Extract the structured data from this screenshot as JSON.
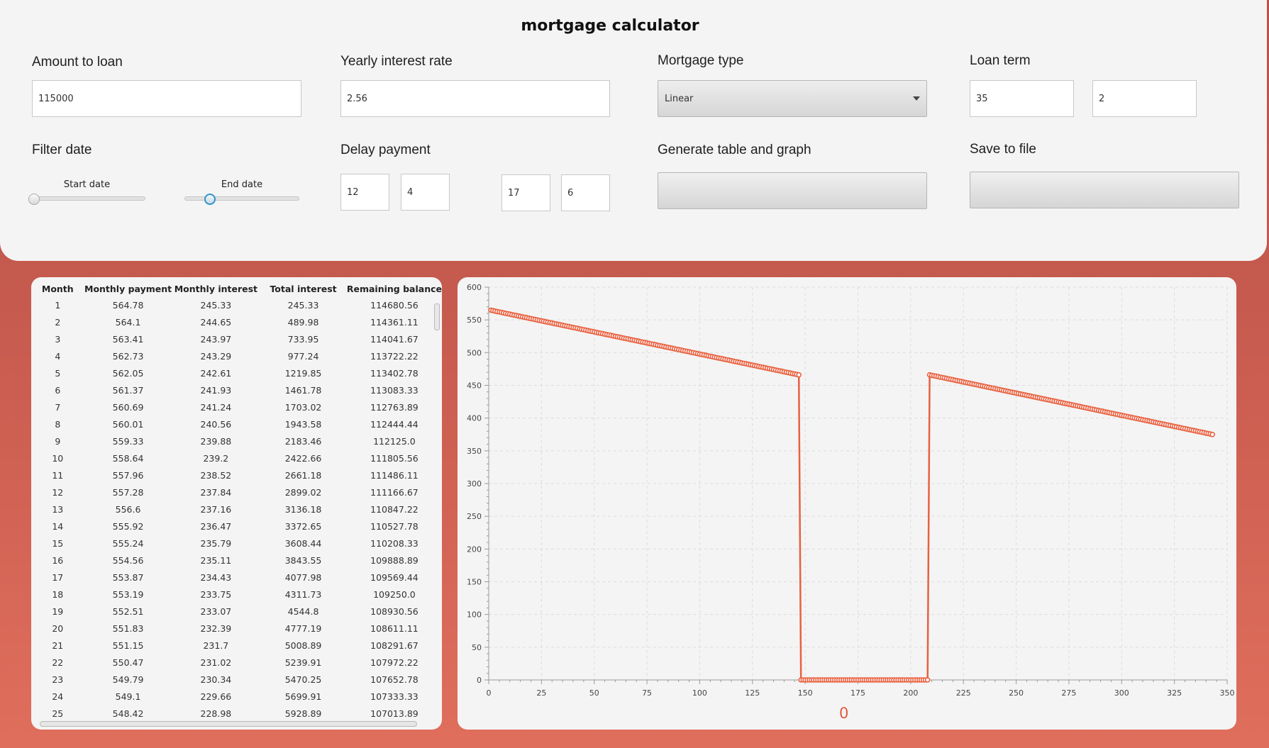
{
  "app": {
    "title": "mortgage calculator"
  },
  "form": {
    "amount_label": "Amount to loan",
    "amount_value": "115000",
    "rate_label": "Yearly interest rate",
    "rate_value": "2.56",
    "type_label": "Mortgage type",
    "type_value": "Linear",
    "term_label": "Loan term",
    "term_years": "35",
    "term_months": "2",
    "filter_label": "Filter date",
    "start_label": "Start date",
    "end_label": "End date",
    "start_slider_value": 0.0,
    "end_slider_value": 0.19,
    "delay_label": "Delay payment",
    "delay_1": "12",
    "delay_2": "4",
    "delay_3": "17",
    "delay_4": "6",
    "generate_label": "Generate table and graph",
    "save_label": "Save to file"
  },
  "table": {
    "columns": [
      "Month",
      "Monthly payment",
      "Monthly interest",
      "Total interest",
      "Remaining balance"
    ],
    "rows": [
      [
        "1",
        "564.78",
        "245.33",
        "245.33",
        "114680.56"
      ],
      [
        "2",
        "564.1",
        "244.65",
        "489.98",
        "114361.11"
      ],
      [
        "3",
        "563.41",
        "243.97",
        "733.95",
        "114041.67"
      ],
      [
        "4",
        "562.73",
        "243.29",
        "977.24",
        "113722.22"
      ],
      [
        "5",
        "562.05",
        "242.61",
        "1219.85",
        "113402.78"
      ],
      [
        "6",
        "561.37",
        "241.93",
        "1461.78",
        "113083.33"
      ],
      [
        "7",
        "560.69",
        "241.24",
        "1703.02",
        "112763.89"
      ],
      [
        "8",
        "560.01",
        "240.56",
        "1943.58",
        "112444.44"
      ],
      [
        "9",
        "559.33",
        "239.88",
        "2183.46",
        "112125.0"
      ],
      [
        "10",
        "558.64",
        "239.2",
        "2422.66",
        "111805.56"
      ],
      [
        "11",
        "557.96",
        "238.52",
        "2661.18",
        "111486.11"
      ],
      [
        "12",
        "557.28",
        "237.84",
        "2899.02",
        "111166.67"
      ],
      [
        "13",
        "556.6",
        "237.16",
        "3136.18",
        "110847.22"
      ],
      [
        "14",
        "555.92",
        "236.47",
        "3372.65",
        "110527.78"
      ],
      [
        "15",
        "555.24",
        "235.79",
        "3608.44",
        "110208.33"
      ],
      [
        "16",
        "554.56",
        "235.11",
        "3843.55",
        "109888.89"
      ],
      [
        "17",
        "553.87",
        "234.43",
        "4077.98",
        "109569.44"
      ],
      [
        "18",
        "553.19",
        "233.75",
        "4311.73",
        "109250.0"
      ],
      [
        "19",
        "552.51",
        "233.07",
        "4544.8",
        "108930.56"
      ],
      [
        "20",
        "551.83",
        "232.39",
        "4777.19",
        "108611.11"
      ],
      [
        "21",
        "551.15",
        "231.7",
        "5008.89",
        "108291.67"
      ],
      [
        "22",
        "550.47",
        "231.02",
        "5239.91",
        "107972.22"
      ],
      [
        "23",
        "549.79",
        "230.34",
        "5470.25",
        "107652.78"
      ],
      [
        "24",
        "549.1",
        "229.66",
        "5699.91",
        "107333.33"
      ],
      [
        "25",
        "548.42",
        "228.98",
        "5928.89",
        "107013.89"
      ]
    ]
  },
  "chart_data": {
    "type": "line",
    "title": "",
    "xlabel": "",
    "ylabel": "",
    "xlim": [
      0,
      350
    ],
    "ylim": [
      0,
      600
    ],
    "x_ticks": [
      "0",
      "25",
      "50",
      "75",
      "100",
      "125",
      "150",
      "175",
      "200",
      "225",
      "250",
      "275",
      "300",
      "325",
      "350"
    ],
    "y_ticks": [
      "0",
      "50",
      "100",
      "150",
      "200",
      "250",
      "300",
      "350",
      "400",
      "450",
      "500",
      "550",
      "600"
    ],
    "grid": true,
    "color": "#e8603f",
    "legend_label": "0",
    "series": [
      {
        "name": "0",
        "segments": [
          {
            "x_start": 1,
            "x_end": 147,
            "y_start": 564.78,
            "y_end": 466
          },
          {
            "x_start": 148,
            "x_end": 208,
            "y_start": 0,
            "y_end": 0
          },
          {
            "x_start": 209,
            "x_end": 343,
            "y_start": 466,
            "y_end": 375
          }
        ]
      }
    ]
  }
}
